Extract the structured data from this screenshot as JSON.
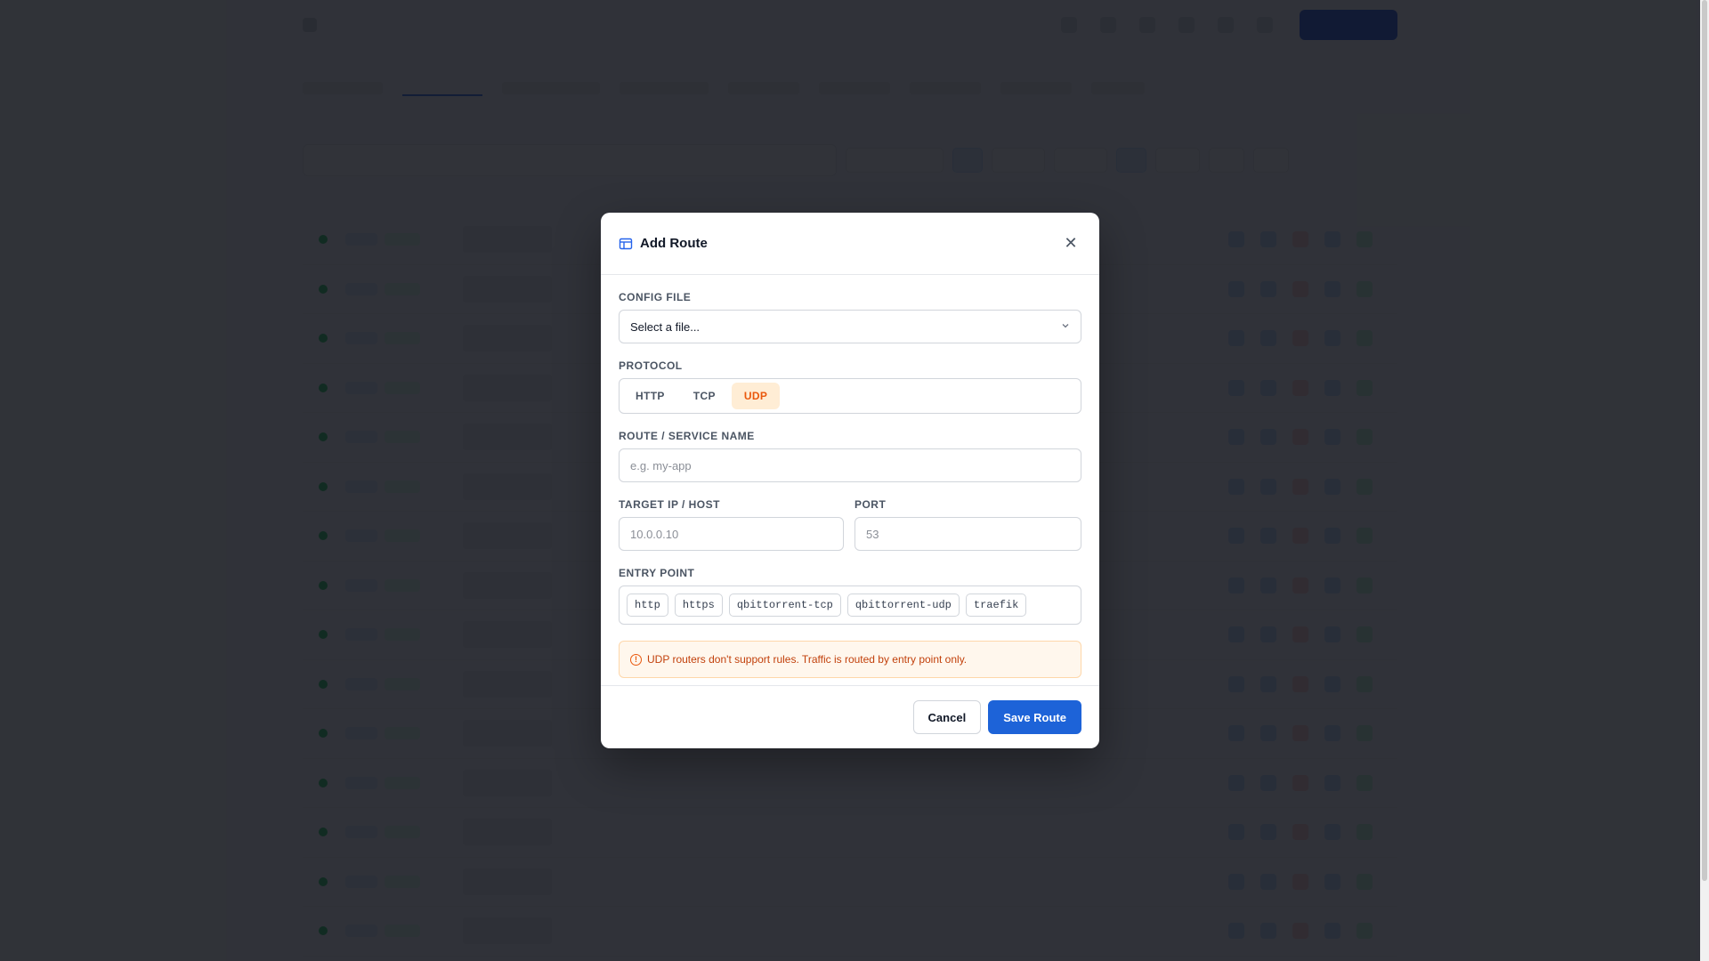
{
  "modal": {
    "title": "Add Route",
    "close_symbol": "✕",
    "config_file": {
      "label": "CONFIG FILE",
      "value": "Select a file..."
    },
    "protocol": {
      "label": "PROTOCOL",
      "options": [
        "HTTP",
        "TCP",
        "UDP"
      ],
      "selected": "UDP"
    },
    "route_name": {
      "label": "ROUTE / SERVICE NAME",
      "placeholder": "e.g. my-app"
    },
    "target": {
      "label": "TARGET IP / HOST",
      "placeholder": "10.0.0.10"
    },
    "port": {
      "label": "PORT",
      "placeholder": "53"
    },
    "entry_point": {
      "label": "ENTRY POINT",
      "options": [
        "http",
        "https",
        "qbittorrent-tcp",
        "qbittorrent-udp",
        "traefik"
      ]
    },
    "alert": {
      "text": "UDP routers don't support rules. Traffic is routed by entry point only."
    },
    "cancel_label": "Cancel",
    "save_label": "Save Route"
  },
  "colors": {
    "accent": "#1d63d8",
    "udp_highlight": "#ea580c",
    "alert_bg": "#fff7ed"
  }
}
